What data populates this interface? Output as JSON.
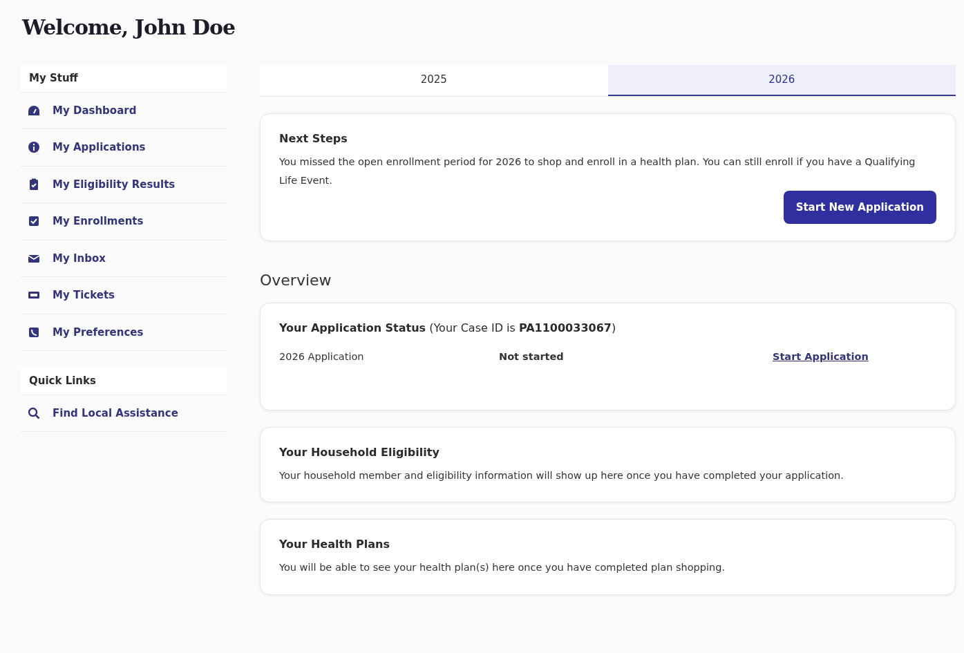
{
  "page_title": "Welcome, John Doe",
  "sidebar": {
    "sections": [
      {
        "heading": "My Stuff",
        "items": [
          {
            "label": "My Dashboard",
            "kind": "dashboard"
          },
          {
            "label": "My Applications",
            "kind": "info"
          },
          {
            "label": "My Eligibility Results",
            "kind": "clipboard"
          },
          {
            "label": "My Enrollments",
            "kind": "checkbox"
          },
          {
            "label": "My Inbox",
            "kind": "envelope"
          },
          {
            "label": "My Tickets",
            "kind": "ticket"
          },
          {
            "label": "My Preferences",
            "kind": "phone"
          }
        ]
      },
      {
        "heading": "Quick Links",
        "items": [
          {
            "label": "Find Local Assistance",
            "kind": "search"
          }
        ]
      }
    ]
  },
  "tabs": [
    {
      "label": "2025",
      "selected": false
    },
    {
      "label": "2026",
      "selected": true
    }
  ],
  "next_steps": {
    "title": "Next Steps",
    "text": "You missed the open enrollment period for 2026 to shop and enroll in a health plan. You can still enroll if you have a Qualifying Life Event.",
    "button": "Start New Application"
  },
  "overview": {
    "heading": "Overview",
    "application_status": {
      "title": "**Your Application Status** (Your Case ID is **PA1100033067**)",
      "row": {
        "name": "2026 Application",
        "status": "Not started",
        "link": "Start Application"
      }
    },
    "household": {
      "title": "Your Household Eligibility",
      "text": "Your household member and eligibility information will show up here once you have completed your application."
    },
    "health_plans": {
      "title": "Your Health Plans",
      "text": "You will be able to see your health plan(s) here once you have completed plan shopping."
    }
  }
}
